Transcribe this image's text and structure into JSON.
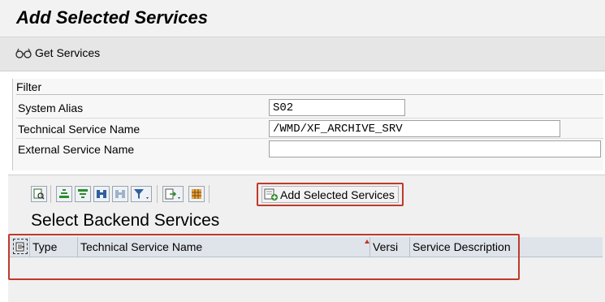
{
  "page": {
    "title": "Add Selected Services"
  },
  "toolbar": {
    "get_services_label": "Get Services",
    "get_services_icon": "glasses-icon"
  },
  "filter": {
    "title": "Filter",
    "fields": [
      {
        "label": "System Alias",
        "value": "S02"
      },
      {
        "label": "Technical Service Name",
        "value": "/WMD/XF_ARCHIVE_SRV"
      },
      {
        "label": "External Service Name",
        "value": ""
      }
    ]
  },
  "grid": {
    "add_button_label": "Add Selected Services",
    "title": "Select Backend Services",
    "columns": [
      "Type",
      "Technical Service Name",
      "Versi",
      "Service Description"
    ],
    "rows": []
  },
  "colors": {
    "highlight": "#c0392b",
    "sort_marker": "#c0392b"
  }
}
